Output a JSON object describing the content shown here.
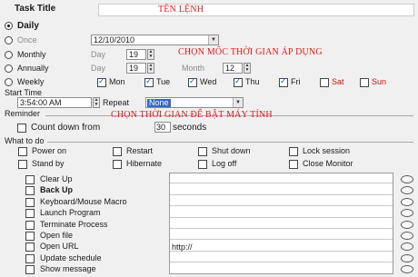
{
  "title_label": "Task Title",
  "title_value": "TÊN LỆNH",
  "schedule": {
    "daily": "Daily",
    "once": "Once",
    "once_date": "12/10/2010",
    "monthly": "Monthly",
    "monthly_day_label": "Day",
    "monthly_day_value": "19",
    "annually": "Annually",
    "annually_day_label": "Day",
    "annually_day_value": "19",
    "annually_month_label": "Month",
    "annually_month_value": "12",
    "weekly": "Weekly",
    "days": [
      "Mon",
      "Tue",
      "Wed",
      "Thu",
      "Fri",
      "Sat",
      "Sun"
    ]
  },
  "annotation_schedule": "CHỌN MỐC THỜI GIAN ÁP DỤNG",
  "start_time": {
    "label": "Start Time",
    "value": "3:54:00 AM",
    "repeat_label": "Repeat",
    "repeat_value": "None"
  },
  "reminder": {
    "label": "Reminder",
    "countdown_label": "Count down from",
    "countdown_value": "30",
    "seconds_label": "seconds"
  },
  "annotation_reminder": "CHỌN THỜI GIAN ĐỂ BẬT MÁY TÍNH",
  "what_to_do": {
    "label": "What to do",
    "power_options": [
      "Power on",
      "Restart",
      "Shut down",
      "Lock session",
      "Stand by",
      "Hibernate",
      "Log off",
      "Close Monitor"
    ],
    "actions": [
      "Clear Up",
      "Back Up",
      "Keyboard/Mouse Macro",
      "Launch Program",
      "Terminate Process",
      "Open file",
      "Open URL",
      "Update schedule",
      "Show message"
    ],
    "url_value": "http://"
  },
  "colors": {
    "annotation": "#e01818",
    "weekend": "#d01010",
    "check": "#1a5fb4"
  }
}
